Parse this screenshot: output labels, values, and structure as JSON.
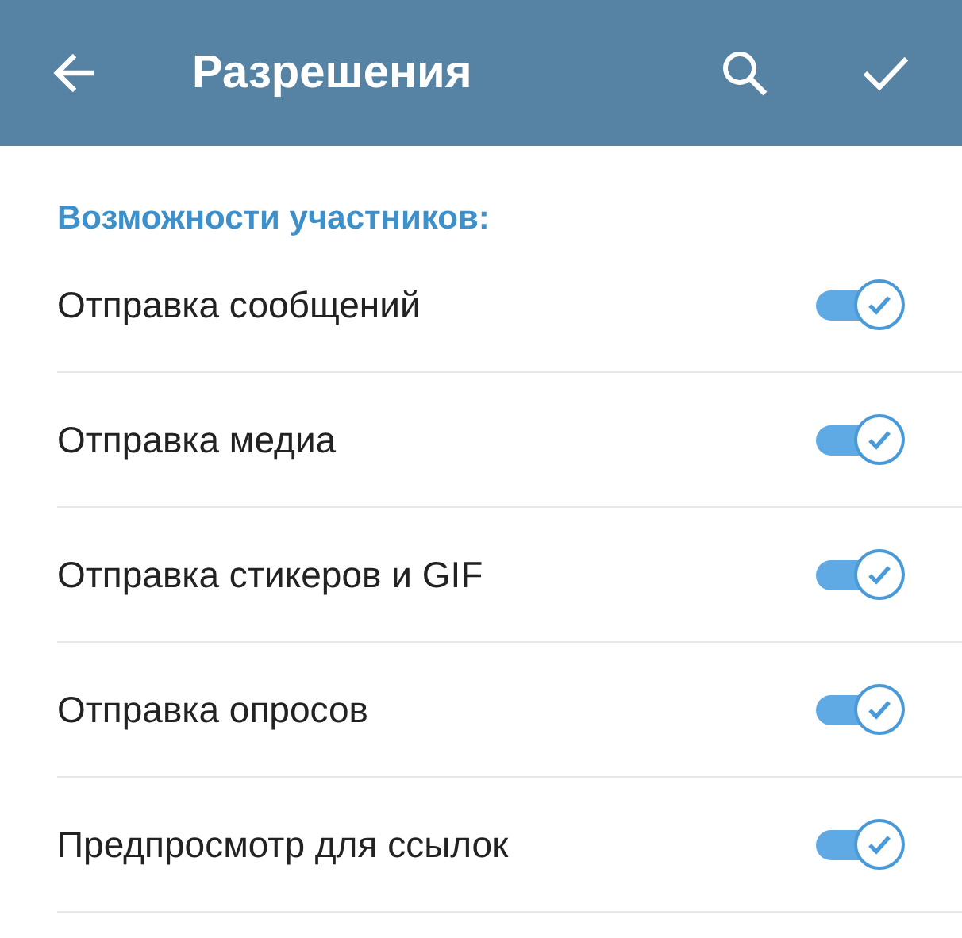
{
  "header": {
    "title": "Разрешения"
  },
  "section": {
    "title": "Возможности участников:"
  },
  "permissions": [
    {
      "label": "Отправка сообщений",
      "on": true
    },
    {
      "label": "Отправка медиа",
      "on": true
    },
    {
      "label": "Отправка стикеров и GIF",
      "on": true
    },
    {
      "label": "Отправка опросов",
      "on": true
    },
    {
      "label": "Предпросмотр для ссылок",
      "on": true
    }
  ]
}
